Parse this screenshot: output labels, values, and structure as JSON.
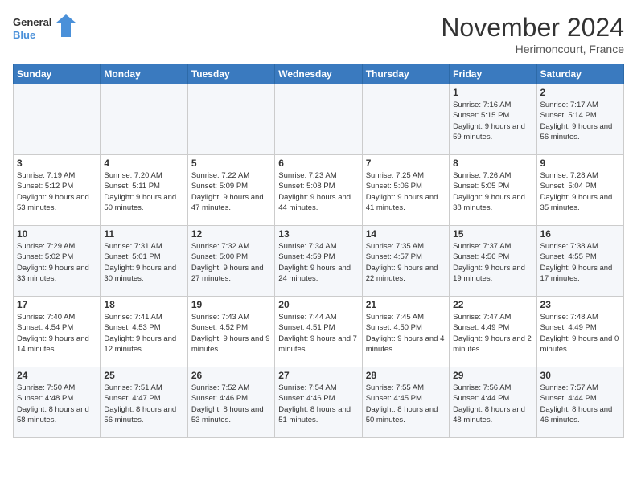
{
  "logo": {
    "line1": "General",
    "line2": "Blue"
  },
  "title": "November 2024",
  "location": "Herimoncourt, France",
  "days_of_week": [
    "Sunday",
    "Monday",
    "Tuesday",
    "Wednesday",
    "Thursday",
    "Friday",
    "Saturday"
  ],
  "weeks": [
    [
      {
        "day": "",
        "info": ""
      },
      {
        "day": "",
        "info": ""
      },
      {
        "day": "",
        "info": ""
      },
      {
        "day": "",
        "info": ""
      },
      {
        "day": "",
        "info": ""
      },
      {
        "day": "1",
        "info": "Sunrise: 7:16 AM\nSunset: 5:15 PM\nDaylight: 9 hours and 59 minutes."
      },
      {
        "day": "2",
        "info": "Sunrise: 7:17 AM\nSunset: 5:14 PM\nDaylight: 9 hours and 56 minutes."
      }
    ],
    [
      {
        "day": "3",
        "info": "Sunrise: 7:19 AM\nSunset: 5:12 PM\nDaylight: 9 hours and 53 minutes."
      },
      {
        "day": "4",
        "info": "Sunrise: 7:20 AM\nSunset: 5:11 PM\nDaylight: 9 hours and 50 minutes."
      },
      {
        "day": "5",
        "info": "Sunrise: 7:22 AM\nSunset: 5:09 PM\nDaylight: 9 hours and 47 minutes."
      },
      {
        "day": "6",
        "info": "Sunrise: 7:23 AM\nSunset: 5:08 PM\nDaylight: 9 hours and 44 minutes."
      },
      {
        "day": "7",
        "info": "Sunrise: 7:25 AM\nSunset: 5:06 PM\nDaylight: 9 hours and 41 minutes."
      },
      {
        "day": "8",
        "info": "Sunrise: 7:26 AM\nSunset: 5:05 PM\nDaylight: 9 hours and 38 minutes."
      },
      {
        "day": "9",
        "info": "Sunrise: 7:28 AM\nSunset: 5:04 PM\nDaylight: 9 hours and 35 minutes."
      }
    ],
    [
      {
        "day": "10",
        "info": "Sunrise: 7:29 AM\nSunset: 5:02 PM\nDaylight: 9 hours and 33 minutes."
      },
      {
        "day": "11",
        "info": "Sunrise: 7:31 AM\nSunset: 5:01 PM\nDaylight: 9 hours and 30 minutes."
      },
      {
        "day": "12",
        "info": "Sunrise: 7:32 AM\nSunset: 5:00 PM\nDaylight: 9 hours and 27 minutes."
      },
      {
        "day": "13",
        "info": "Sunrise: 7:34 AM\nSunset: 4:59 PM\nDaylight: 9 hours and 24 minutes."
      },
      {
        "day": "14",
        "info": "Sunrise: 7:35 AM\nSunset: 4:57 PM\nDaylight: 9 hours and 22 minutes."
      },
      {
        "day": "15",
        "info": "Sunrise: 7:37 AM\nSunset: 4:56 PM\nDaylight: 9 hours and 19 minutes."
      },
      {
        "day": "16",
        "info": "Sunrise: 7:38 AM\nSunset: 4:55 PM\nDaylight: 9 hours and 17 minutes."
      }
    ],
    [
      {
        "day": "17",
        "info": "Sunrise: 7:40 AM\nSunset: 4:54 PM\nDaylight: 9 hours and 14 minutes."
      },
      {
        "day": "18",
        "info": "Sunrise: 7:41 AM\nSunset: 4:53 PM\nDaylight: 9 hours and 12 minutes."
      },
      {
        "day": "19",
        "info": "Sunrise: 7:43 AM\nSunset: 4:52 PM\nDaylight: 9 hours and 9 minutes."
      },
      {
        "day": "20",
        "info": "Sunrise: 7:44 AM\nSunset: 4:51 PM\nDaylight: 9 hours and 7 minutes."
      },
      {
        "day": "21",
        "info": "Sunrise: 7:45 AM\nSunset: 4:50 PM\nDaylight: 9 hours and 4 minutes."
      },
      {
        "day": "22",
        "info": "Sunrise: 7:47 AM\nSunset: 4:49 PM\nDaylight: 9 hours and 2 minutes."
      },
      {
        "day": "23",
        "info": "Sunrise: 7:48 AM\nSunset: 4:49 PM\nDaylight: 9 hours and 0 minutes."
      }
    ],
    [
      {
        "day": "24",
        "info": "Sunrise: 7:50 AM\nSunset: 4:48 PM\nDaylight: 8 hours and 58 minutes."
      },
      {
        "day": "25",
        "info": "Sunrise: 7:51 AM\nSunset: 4:47 PM\nDaylight: 8 hours and 56 minutes."
      },
      {
        "day": "26",
        "info": "Sunrise: 7:52 AM\nSunset: 4:46 PM\nDaylight: 8 hours and 53 minutes."
      },
      {
        "day": "27",
        "info": "Sunrise: 7:54 AM\nSunset: 4:46 PM\nDaylight: 8 hours and 51 minutes."
      },
      {
        "day": "28",
        "info": "Sunrise: 7:55 AM\nSunset: 4:45 PM\nDaylight: 8 hours and 50 minutes."
      },
      {
        "day": "29",
        "info": "Sunrise: 7:56 AM\nSunset: 4:44 PM\nDaylight: 8 hours and 48 minutes."
      },
      {
        "day": "30",
        "info": "Sunrise: 7:57 AM\nSunset: 4:44 PM\nDaylight: 8 hours and 46 minutes."
      }
    ]
  ]
}
